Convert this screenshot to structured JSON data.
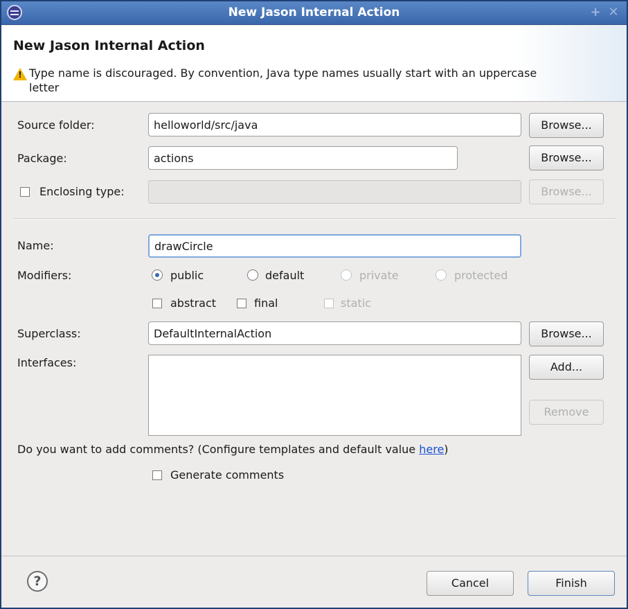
{
  "window": {
    "title": "New Jason Internal Action"
  },
  "header": {
    "title": "New Jason Internal Action",
    "warning": "Type name is discouraged. By convention, Java type names usually start with an uppercase letter"
  },
  "source_folder": {
    "label": "Source folder:",
    "value": "helloworld/src/java",
    "browse": "Browse..."
  },
  "package": {
    "label": "Package:",
    "value": "actions",
    "browse": "Browse..."
  },
  "enclosing": {
    "label": "Enclosing type:",
    "value": "",
    "browse": "Browse...",
    "checked": false
  },
  "name": {
    "label": "Name:",
    "value": "drawCircle"
  },
  "modifiers": {
    "label": "Modifiers:",
    "public": "public",
    "default": "default",
    "private": "private",
    "protected": "protected",
    "selected": "public",
    "abstract": "abstract",
    "final": "final",
    "static": "static"
  },
  "superclass": {
    "label": "Superclass:",
    "value": "DefaultInternalAction",
    "browse": "Browse..."
  },
  "interfaces": {
    "label": "Interfaces:",
    "add": "Add...",
    "remove": "Remove",
    "items": []
  },
  "comments": {
    "question_prefix": "Do you want to add comments? (Configure templates and default value ",
    "link": "here",
    "question_suffix": ")",
    "generate": "Generate comments"
  },
  "footer": {
    "help": "?",
    "cancel": "Cancel",
    "finish": "Finish"
  },
  "titlebar_buttons": {
    "maximize": "+",
    "close": "✕"
  }
}
